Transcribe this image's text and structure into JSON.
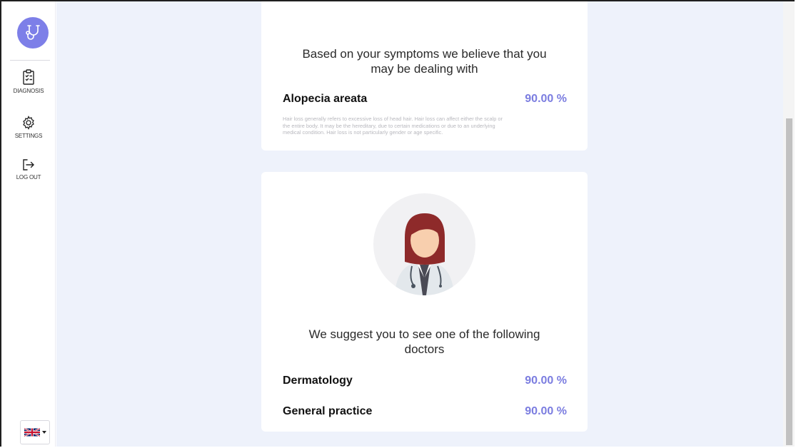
{
  "sidebar": {
    "items": [
      {
        "label": "DIAGNOSIS",
        "icon": "clipboard-icon"
      },
      {
        "label": "SETTINGS",
        "icon": "gear-icon"
      },
      {
        "label": "LOG OUT",
        "icon": "logout-icon"
      }
    ],
    "language": {
      "icon": "uk-flag-icon"
    }
  },
  "diagnosis_card": {
    "heading_line1": "Based on your symptoms we believe that you",
    "heading_line2": "may be dealing with",
    "condition": "Alopecia areata",
    "probability": "90.00 %",
    "description_line1": "Hair loss generally refers to excessive loss of head hair. Hair loss can affect either the scalp or",
    "description_line2": "the entire body. It may be the hereditary, due to certain medications or due to an underlying",
    "description_line3": "medical condition. Hair loss is not particularly gender or age specific."
  },
  "doctors_card": {
    "heading_line1": "We suggest you to see one of the following",
    "heading_line2": "doctors",
    "doctors": [
      {
        "name": "Dermatology",
        "probability": "90.00 %"
      },
      {
        "name": "General practice",
        "probability": "90.00 %"
      }
    ]
  },
  "colors": {
    "accent": "#7d7fe8",
    "background": "#eef2fb"
  }
}
